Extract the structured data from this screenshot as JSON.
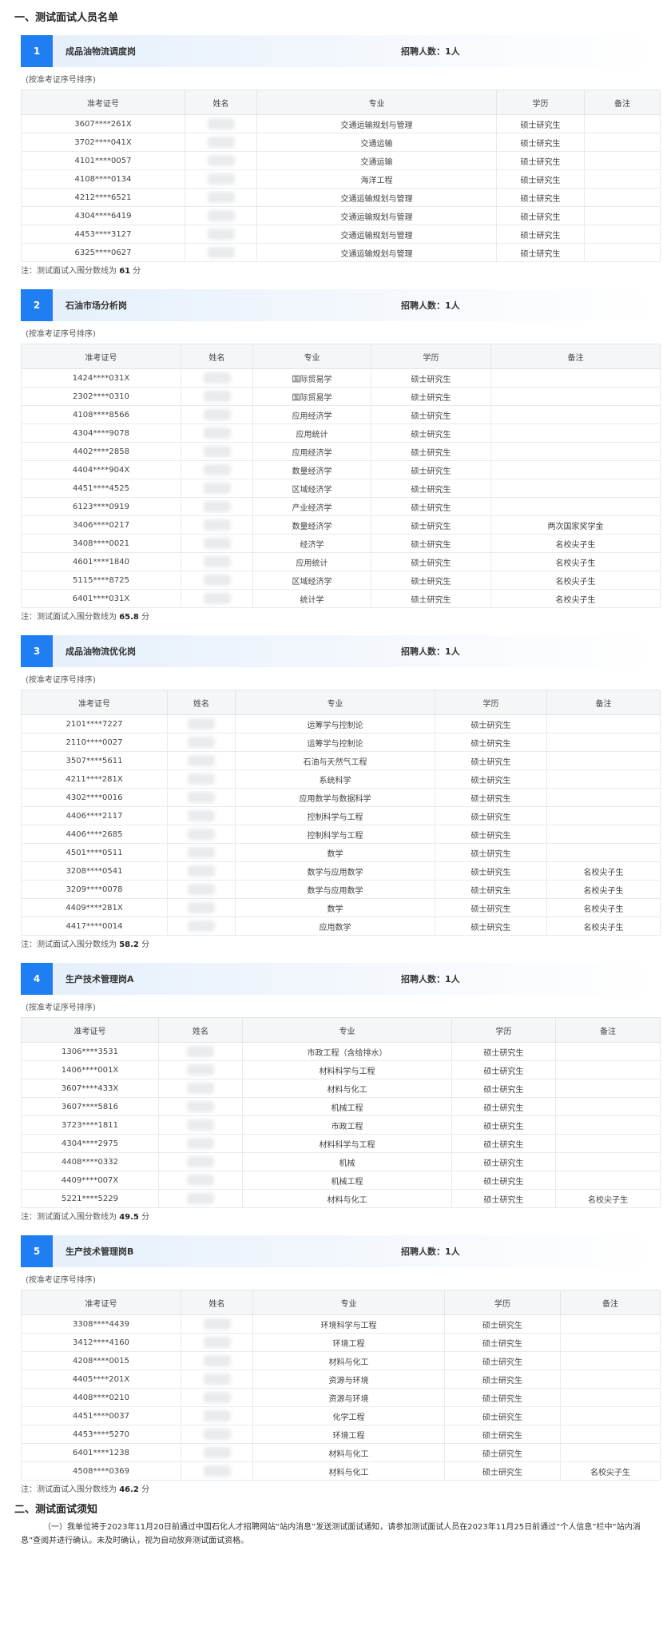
{
  "section1_title": "一、测试面试人员名单",
  "section2_title": "二、测试面试须知",
  "hint": "(按准考证序号排序)",
  "recruit_label": "招聘人数：1人",
  "note_prefix": "注：测试面试入围分数线为",
  "note_suffix": "分",
  "headers": {
    "id": "准考证号",
    "name": "姓名",
    "major": "专业",
    "degree": "学历",
    "remark": "备注"
  },
  "blocks": [
    {
      "num": "1",
      "position": "成品油物流调度岗",
      "cutoff": "61",
      "cols": [
        205,
        90,
        300,
        110,
        95
      ],
      "rows": [
        {
          "id": "3607****261X",
          "major": "交通运输规划与管理",
          "degree": "硕士研究生",
          "remark": ""
        },
        {
          "id": "3702****041X",
          "major": "交通运输",
          "degree": "硕士研究生",
          "remark": ""
        },
        {
          "id": "4101****0057",
          "major": "交通运输",
          "degree": "硕士研究生",
          "remark": ""
        },
        {
          "id": "4108****0134",
          "major": "海洋工程",
          "degree": "硕士研究生",
          "remark": ""
        },
        {
          "id": "4212****6521",
          "major": "交通运输规划与管理",
          "degree": "硕士研究生",
          "remark": ""
        },
        {
          "id": "4304****6419",
          "major": "交通运输规划与管理",
          "degree": "硕士研究生",
          "remark": ""
        },
        {
          "id": "4453****3127",
          "major": "交通运输规划与管理",
          "degree": "硕士研究生",
          "remark": ""
        },
        {
          "id": "6325****0627",
          "major": "交通运输规划与管理",
          "degree": "硕士研究生",
          "remark": ""
        }
      ]
    },
    {
      "num": "2",
      "position": "石油市场分析岗",
      "cutoff": "65.8",
      "cols": [
        200,
        90,
        148,
        150,
        212
      ],
      "rows": [
        {
          "id": "1424****031X",
          "major": "国际贸易学",
          "degree": "硕士研究生",
          "remark": ""
        },
        {
          "id": "2302****0310",
          "major": "国际贸易学",
          "degree": "硕士研究生",
          "remark": ""
        },
        {
          "id": "4108****8566",
          "major": "应用经济学",
          "degree": "硕士研究生",
          "remark": ""
        },
        {
          "id": "4304****9078",
          "major": "应用统计",
          "degree": "硕士研究生",
          "remark": ""
        },
        {
          "id": "4402****2858",
          "major": "应用经济学",
          "degree": "硕士研究生",
          "remark": ""
        },
        {
          "id": "4404****904X",
          "major": "数量经济学",
          "degree": "硕士研究生",
          "remark": ""
        },
        {
          "id": "4451****4525",
          "major": "区域经济学",
          "degree": "硕士研究生",
          "remark": ""
        },
        {
          "id": "6123****0919",
          "major": "产业经济学",
          "degree": "硕士研究生",
          "remark": ""
        },
        {
          "id": "3406****0217",
          "major": "数量经济学",
          "degree": "硕士研究生",
          "remark": "两次国家奖学金"
        },
        {
          "id": "3408****0021",
          "major": "经济学",
          "degree": "硕士研究生",
          "remark": "名校尖子生"
        },
        {
          "id": "4601****1840",
          "major": "应用统计",
          "degree": "硕士研究生",
          "remark": "名校尖子生"
        },
        {
          "id": "5115****8725",
          "major": "区域经济学",
          "degree": "硕士研究生",
          "remark": "名校尖子生"
        },
        {
          "id": "6401****031X",
          "major": "统计学",
          "degree": "硕士研究生",
          "remark": "名校尖子生"
        }
      ]
    },
    {
      "num": "3",
      "position": "成品油物流优化岗",
      "cutoff": "58.2",
      "cols": [
        183,
        85,
        250,
        140,
        142
      ],
      "rows": [
        {
          "id": "2101****7227",
          "major": "运筹学与控制论",
          "degree": "硕士研究生",
          "remark": ""
        },
        {
          "id": "2110****0027",
          "major": "运筹学与控制论",
          "degree": "硕士研究生",
          "remark": ""
        },
        {
          "id": "3507****5611",
          "major": "石油与天然气工程",
          "degree": "硕士研究生",
          "remark": ""
        },
        {
          "id": "4211****281X",
          "major": "系统科学",
          "degree": "硕士研究生",
          "remark": ""
        },
        {
          "id": "4302****0016",
          "major": "应用数学与数据科学",
          "degree": "硕士研究生",
          "remark": ""
        },
        {
          "id": "4406****2117",
          "major": "控制科学与工程",
          "degree": "硕士研究生",
          "remark": ""
        },
        {
          "id": "4406****2685",
          "major": "控制科学与工程",
          "degree": "硕士研究生",
          "remark": ""
        },
        {
          "id": "4501****0511",
          "major": "数学",
          "degree": "硕士研究生",
          "remark": ""
        },
        {
          "id": "3208****0541",
          "major": "数学与应用数学",
          "degree": "硕士研究生",
          "remark": "名校尖子生"
        },
        {
          "id": "3209****0078",
          "major": "数学与应用数学",
          "degree": "硕士研究生",
          "remark": "名校尖子生"
        },
        {
          "id": "4409****281X",
          "major": "数学",
          "degree": "硕士研究生",
          "remark": "名校尖子生"
        },
        {
          "id": "4417****0014",
          "major": "应用数学",
          "degree": "硕士研究生",
          "remark": "名校尖子生"
        }
      ]
    },
    {
      "num": "4",
      "position": "生产技术管理岗A",
      "cutoff": "49.5",
      "cols": [
        172,
        105,
        262,
        130,
        131
      ],
      "rows": [
        {
          "id": "1306****3531",
          "major": "市政工程（含给排水）",
          "degree": "硕士研究生",
          "remark": ""
        },
        {
          "id": "1406****001X",
          "major": "材料科学与工程",
          "degree": "硕士研究生",
          "remark": ""
        },
        {
          "id": "3607****433X",
          "major": "材料与化工",
          "degree": "硕士研究生",
          "remark": ""
        },
        {
          "id": "3607****5816",
          "major": "机械工程",
          "degree": "硕士研究生",
          "remark": ""
        },
        {
          "id": "3723****1811",
          "major": "市政工程",
          "degree": "硕士研究生",
          "remark": ""
        },
        {
          "id": "4304****2975",
          "major": "材料科学与工程",
          "degree": "硕士研究生",
          "remark": ""
        },
        {
          "id": "4408****0332",
          "major": "机械",
          "degree": "硕士研究生",
          "remark": ""
        },
        {
          "id": "4409****007X",
          "major": "机械工程",
          "degree": "硕士研究生",
          "remark": ""
        },
        {
          "id": "5221****5229",
          "major": "材料与化工",
          "degree": "硕士研究生",
          "remark": "名校尖子生"
        }
      ]
    },
    {
      "num": "5",
      "position": "生产技术管理岗B",
      "cutoff": "46.2",
      "cols": [
        200,
        90,
        240,
        145,
        125
      ],
      "rows": [
        {
          "id": "3308****4439",
          "major": "环境科学与工程",
          "degree": "硕士研究生",
          "remark": ""
        },
        {
          "id": "3412****4160",
          "major": "环境工程",
          "degree": "硕士研究生",
          "remark": ""
        },
        {
          "id": "4208****0015",
          "major": "材料与化工",
          "degree": "硕士研究生",
          "remark": ""
        },
        {
          "id": "4405****201X",
          "major": "资源与环境",
          "degree": "硕士研究生",
          "remark": ""
        },
        {
          "id": "4408****0210",
          "major": "资源与环境",
          "degree": "硕士研究生",
          "remark": ""
        },
        {
          "id": "4451****0037",
          "major": "化学工程",
          "degree": "硕士研究生",
          "remark": ""
        },
        {
          "id": "4453****5270",
          "major": "环境工程",
          "degree": "硕士研究生",
          "remark": ""
        },
        {
          "id": "6401****1238",
          "major": "材料与化工",
          "degree": "硕士研究生",
          "remark": ""
        },
        {
          "id": "4508****0369",
          "major": "材料与化工",
          "degree": "硕士研究生",
          "remark": "名校尖子生"
        }
      ]
    }
  ],
  "notice_text": "（一）我单位将于2023年11月20日前通过中国石化人才招聘网站“站内消息”发送测试面试通知，请参加测试面试人员在2023年11月25日前通过“个人信息”栏中“站内消息”查阅并进行确认。未及时确认，视为自动放弃测试面试资格。"
}
